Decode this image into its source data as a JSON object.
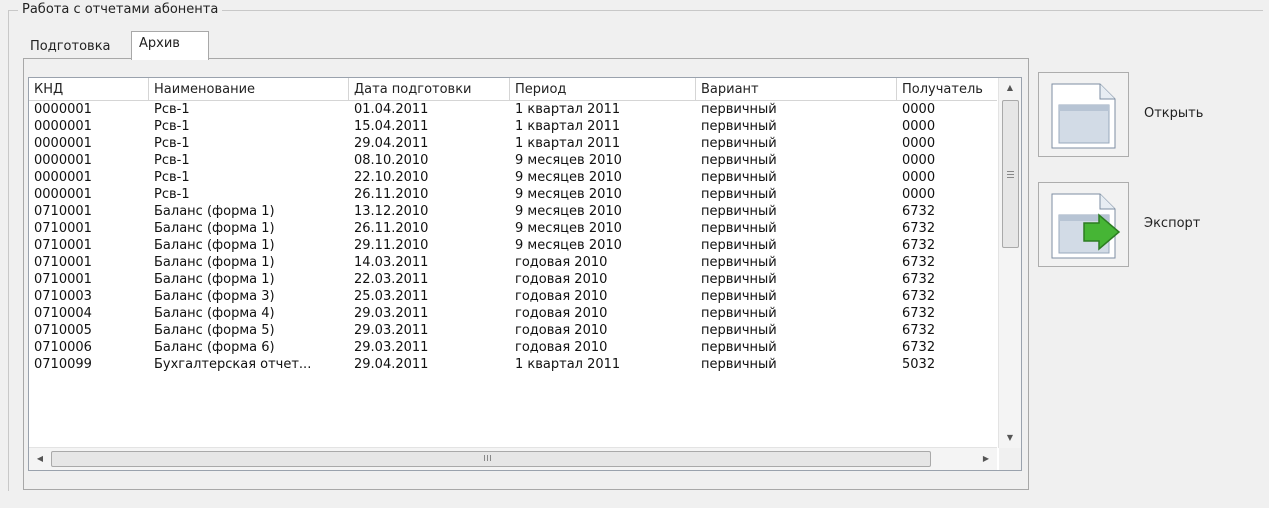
{
  "group": {
    "title": "Работа с отчетами абонента"
  },
  "tabs": [
    {
      "label": "Подготовка",
      "active": false
    },
    {
      "label": "Архив",
      "active": true
    }
  ],
  "table": {
    "columns": [
      "КНД",
      "Наименование",
      "Дата подготовки",
      "Период",
      "Вариант",
      "Получатель"
    ],
    "rows": [
      [
        "0000001",
        "Рсв-1",
        "01.04.2011",
        "1 квартал 2011",
        "первичный",
        "0000"
      ],
      [
        "0000001",
        "Рсв-1",
        "15.04.2011",
        "1 квартал 2011",
        "первичный",
        "0000"
      ],
      [
        "0000001",
        "Рсв-1",
        "29.04.2011",
        "1 квартал 2011",
        "первичный",
        "0000"
      ],
      [
        "0000001",
        "Рсв-1",
        "08.10.2010",
        "9 месяцев 2010",
        "первичный",
        "0000"
      ],
      [
        "0000001",
        "Рсв-1",
        "22.10.2010",
        "9 месяцев 2010",
        "первичный",
        "0000"
      ],
      [
        "0000001",
        "Рсв-1",
        "26.11.2010",
        "9 месяцев 2010",
        "первичный",
        "0000"
      ],
      [
        "0710001",
        "Баланс (форма 1)",
        "13.12.2010",
        "9 месяцев 2010",
        "первичный",
        "6732"
      ],
      [
        "0710001",
        "Баланс (форма 1)",
        "26.11.2010",
        "9 месяцев 2010",
        "первичный",
        "6732"
      ],
      [
        "0710001",
        "Баланс (форма 1)",
        "29.11.2010",
        "9 месяцев 2010",
        "первичный",
        "6732"
      ],
      [
        "0710001",
        "Баланс (форма 1)",
        "14.03.2011",
        "годовая 2010",
        "первичный",
        "6732"
      ],
      [
        "0710001",
        "Баланс (форма 1)",
        "22.03.2011",
        "годовая 2010",
        "первичный",
        "6732"
      ],
      [
        "0710003",
        "Баланс (форма 3)",
        "25.03.2011",
        "годовая 2010",
        "первичный",
        "6732"
      ],
      [
        "0710004",
        "Баланс (форма 4)",
        "29.03.2011",
        "годовая 2010",
        "первичный",
        "6732"
      ],
      [
        "0710005",
        "Баланс (форма 5)",
        "29.03.2011",
        "годовая 2010",
        "первичный",
        "6732"
      ],
      [
        "0710006",
        "Баланс (форма 6)",
        "29.03.2011",
        "годовая 2010",
        "первичный",
        "6732"
      ],
      [
        "0710099",
        "Бухгалтерская отчет...",
        "29.04.2011",
        "1 квартал 2011",
        "первичный",
        "5032"
      ]
    ]
  },
  "buttons": {
    "open": {
      "label": "Открыть",
      "icon": "document-icon"
    },
    "export": {
      "label": "Экспорт",
      "icon": "export-arrow-icon"
    }
  }
}
